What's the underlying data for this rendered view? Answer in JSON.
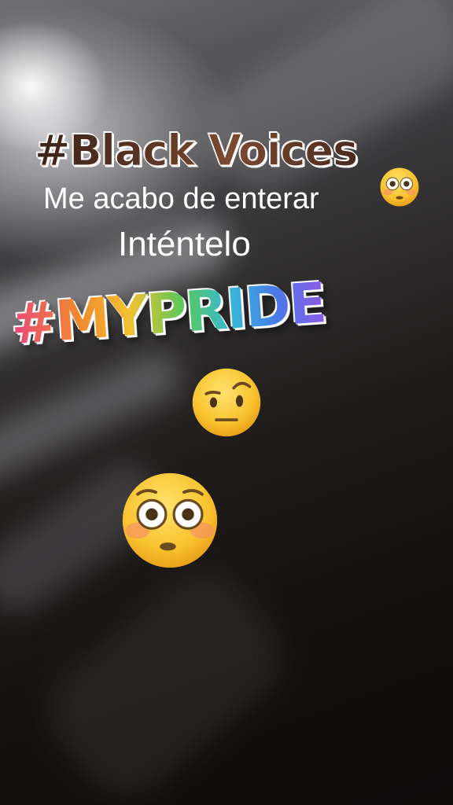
{
  "stickers": {
    "black_voices": "#Black Voices",
    "my_pride": "#MYPRIDE"
  },
  "captions": {
    "line1": "Me acabo de enterar",
    "line2": "Inténtelo"
  },
  "emojis": {
    "small_flushed": "flushed-face-icon",
    "raised_eyebrow": "face-with-raised-eyebrow-icon",
    "large_flushed": "flushed-face-icon"
  },
  "colors": {
    "emoji_yellow": "#f7b928",
    "black_voices_brown": "#5b3524"
  }
}
